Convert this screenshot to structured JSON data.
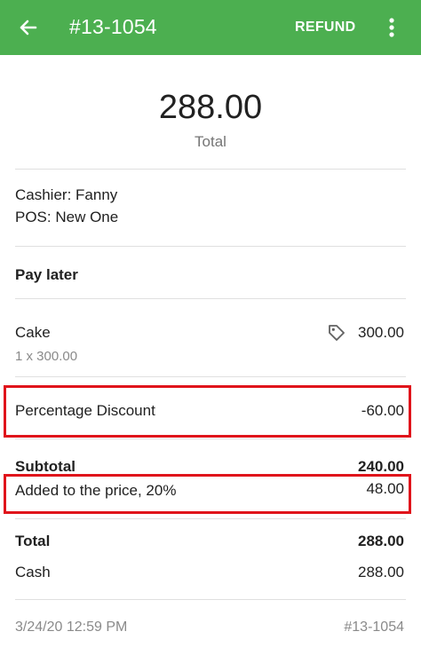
{
  "header": {
    "back_icon": "arrow-left-icon",
    "receipt_number": "#13-1054",
    "refund_label": "REFUND",
    "more_icon": "more-vertical-icon",
    "background_color": "#4caf50"
  },
  "summary": {
    "total_amount": "288.00",
    "total_label": "Total"
  },
  "info": {
    "cashier": "Cashier: Fanny",
    "pos": "POS: New One"
  },
  "payment_status": "Pay later",
  "items": [
    {
      "name": "Cake",
      "icon": "price-tag-icon",
      "amount": "300.00",
      "detail": "1 x 300.00"
    }
  ],
  "discount": {
    "label": "Percentage Discount",
    "amount": "-60.00"
  },
  "subtotal": {
    "label": "Subtotal",
    "amount": "240.00"
  },
  "tax": {
    "label": "Added to the price, 20%",
    "amount": "48.00"
  },
  "totals": {
    "total_label": "Total",
    "total_amount": "288.00",
    "payment_method": "Cash",
    "payment_amount": "288.00"
  },
  "footer": {
    "datetime": "3/24/20 12:59 PM",
    "receipt_number": "#13-1054"
  },
  "highlight_color": "#e0141b"
}
